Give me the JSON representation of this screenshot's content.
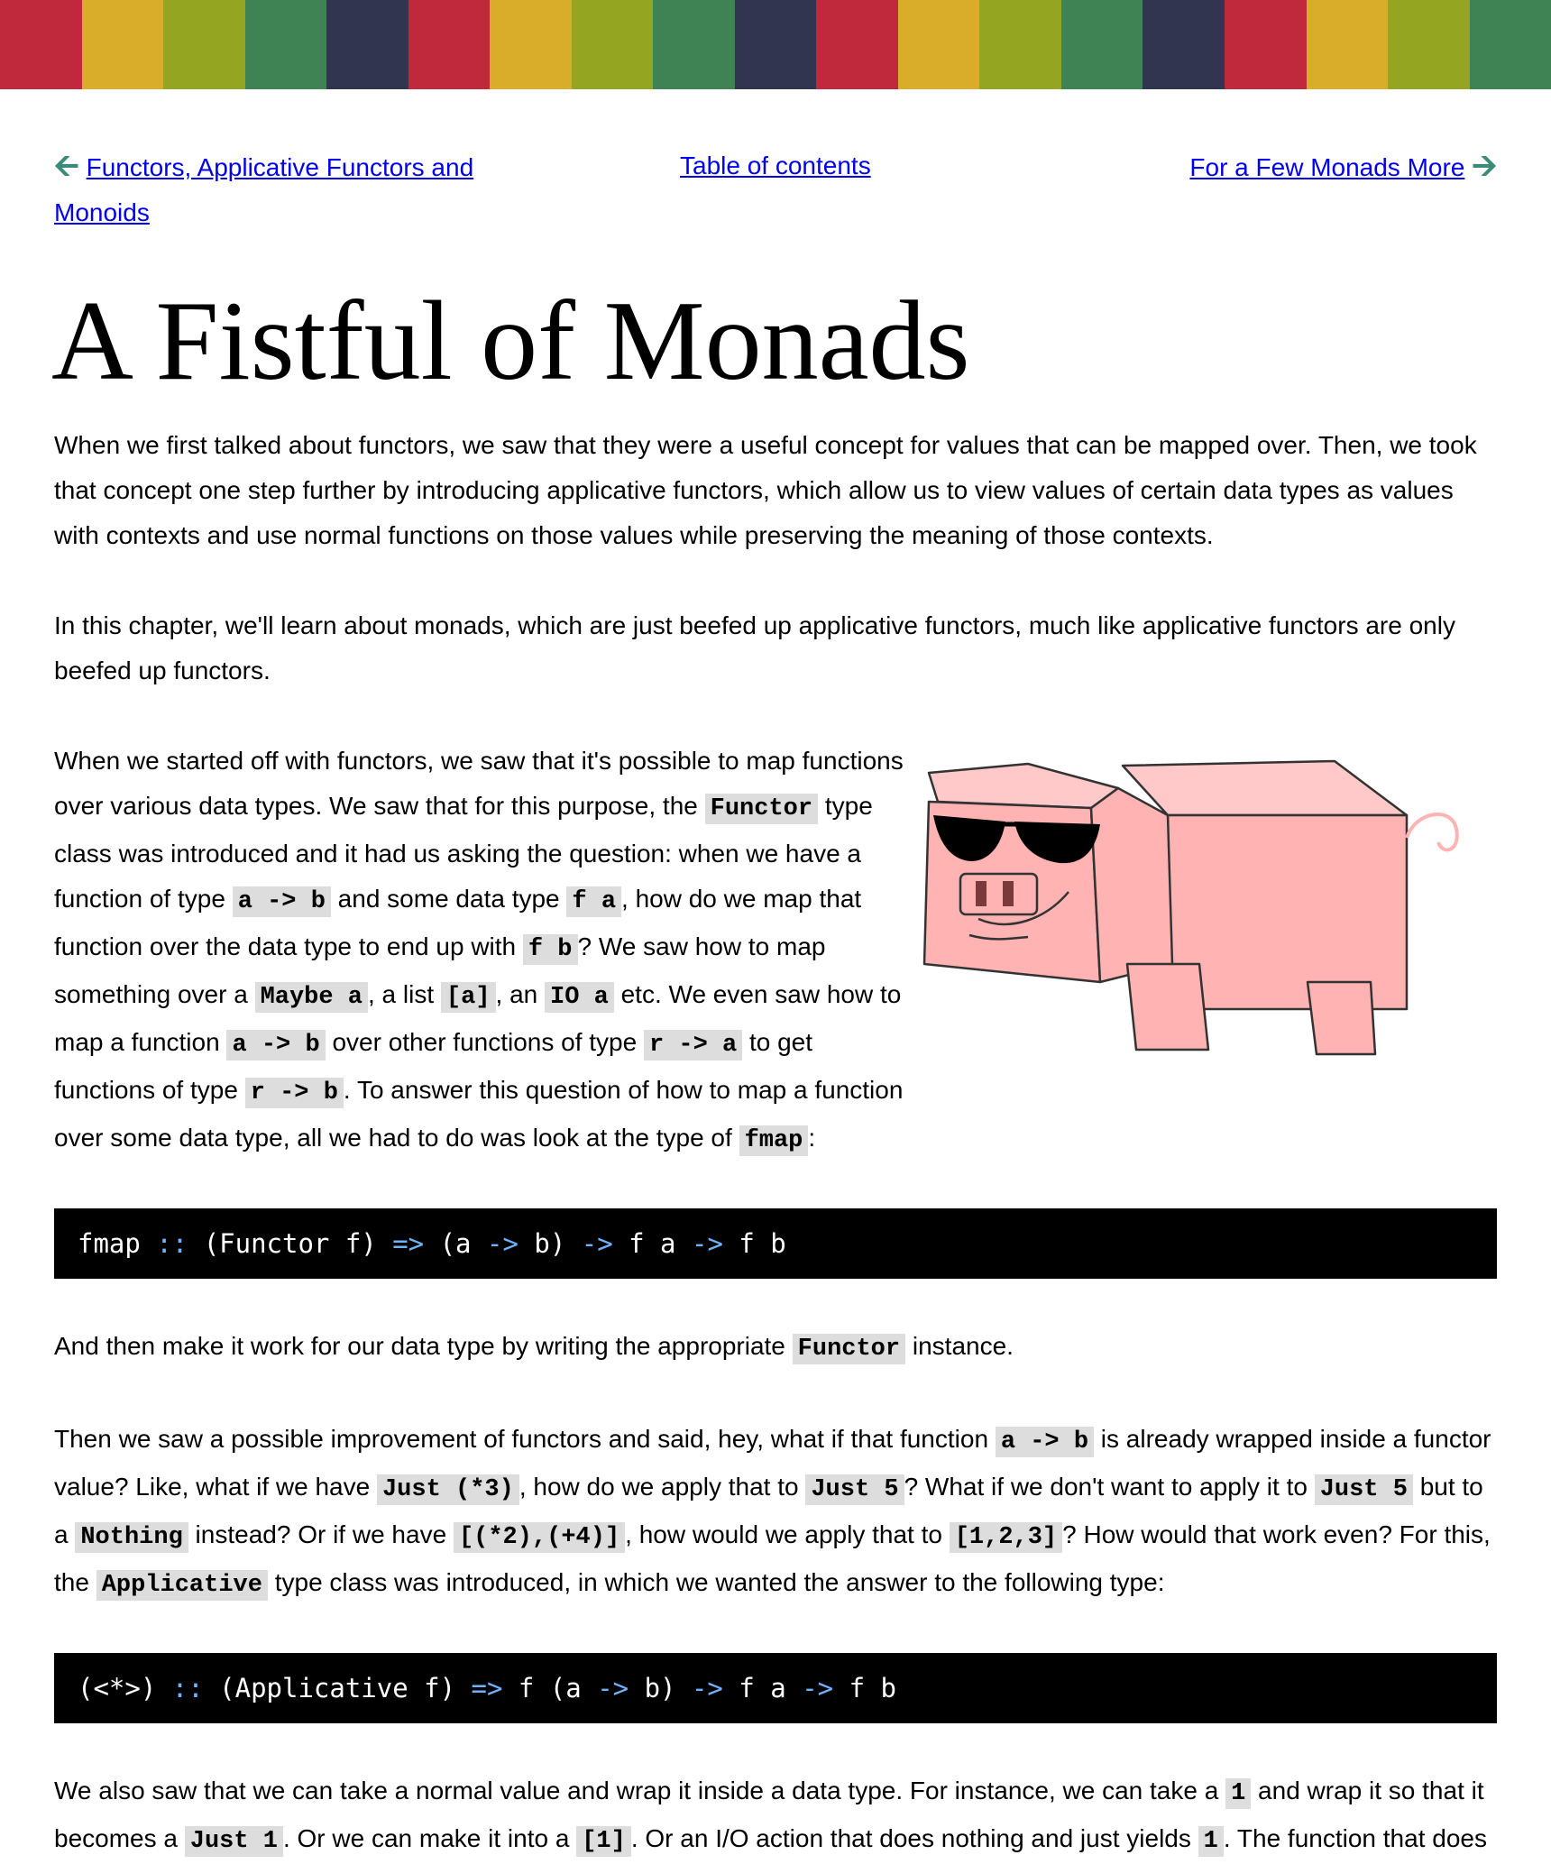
{
  "stripe_colors": [
    "#c0293b",
    "#d9ac2a",
    "#93a521",
    "#3f8355",
    "#32354f",
    "#c0293b",
    "#d9ac2a",
    "#93a521",
    "#3f8355",
    "#32354f",
    "#c0293b",
    "#d9ac2a",
    "#93a521",
    "#3f8355",
    "#32354f",
    "#c0293b",
    "#d9ac2a",
    "#93a521",
    "#3f8355"
  ],
  "nav": {
    "prev_label": "Functors, Applicative Functors and Monoids",
    "toc_label": "Table of contents",
    "next_label": "For a Few Monads More"
  },
  "title": "A Fistful of Monads",
  "p1": "When we first talked about functors, we saw that they were a useful concept for values that can be mapped over. Then, we took that concept one step further by introducing applicative functors, which allow us to view values of certain data types as values with contexts and use normal functions on those values while preserving the meaning of those contexts.",
  "p2": "In this chapter, we'll learn about monads, which are just beefed up applicative functors, much like applicative functors are only beefed up functors.",
  "p3": {
    "t1": "When we started off with functors, we saw that it's possible to map functions over various data types. We saw that for this purpose, the ",
    "c1": "Functor",
    "t2": " type class was introduced and it had us asking the question: when we have a function of type ",
    "c2": "a -> b",
    "t3": " and some data type ",
    "c3": "f a",
    "t4": ", how do we map that function over the data type to end up with ",
    "c4": "f b",
    "t5": "? We saw how to map something over a ",
    "c5": "Maybe a",
    "t6": ", a list ",
    "c6": "[a]",
    "t7": ", an ",
    "c7": "IO a",
    "t8": " etc. We even saw how to map a function ",
    "c8": "a -> b",
    "t9": " over other functions of type ",
    "c9": "r -> a",
    "t10": " to get functions of type ",
    "c10": "r -> b",
    "t11": ". To answer this question of how to map a function over some data type, all we had to do was look at the type of ",
    "c11": "fmap",
    "t12": ":"
  },
  "code1": {
    "a": "fmap ",
    "op1": "::",
    "b": " (Functor f) ",
    "op2": "=>",
    "c": " (a ",
    "op3": "->",
    "d": " b) ",
    "op4": "->",
    "e": " f a ",
    "op5": "->",
    "f": " f b"
  },
  "p4": {
    "t1": "And then make it work for our data type by writing the appropriate ",
    "c1": "Functor",
    "t2": " instance."
  },
  "p5": {
    "t1": "Then we saw a possible improvement of functors and said, hey, what if that function ",
    "c1": "a -> b",
    "t2": " is already wrapped inside a functor value? Like, what if we have ",
    "c2": "Just (*3)",
    "t3": ", how do we apply that to ",
    "c3": "Just 5",
    "t4": "? What if we don't want to apply it to ",
    "c4": "Just 5",
    "t5": " but to a ",
    "c5": "Nothing",
    "t6": " instead? Or if we have ",
    "c6": "[(*2),(+4)]",
    "t7": ", how would we apply that to ",
    "c7": "[1,2,3]",
    "t8": "? How would that work even? For this, the ",
    "c8": "Applicative",
    "t9": " type class was introduced, in which we wanted the answer to the following type:"
  },
  "code2": {
    "a": "(<*>) ",
    "op1": "::",
    "b": " (Applicative f) ",
    "op2": "=>",
    "c": " f (a ",
    "op3": "->",
    "d": " b) ",
    "op4": "->",
    "e": " f a ",
    "op5": "->",
    "f": " f b"
  },
  "p6": {
    "t1": "We also saw that we can take a normal value and wrap it inside a data type. For instance, we can take a ",
    "c1": "1",
    "t2": " and wrap it so that it becomes a ",
    "c2": "Just 1",
    "t3": ". Or we can make it into a ",
    "c3": "[1]",
    "t4": ". Or an I/O action that does nothing and just yields ",
    "c4": "1",
    "t5": ". The function that does"
  },
  "pig": {
    "body_color": "#ffb3b3",
    "shade_color": "#ffc9c9",
    "glasses_color": "#000000"
  }
}
